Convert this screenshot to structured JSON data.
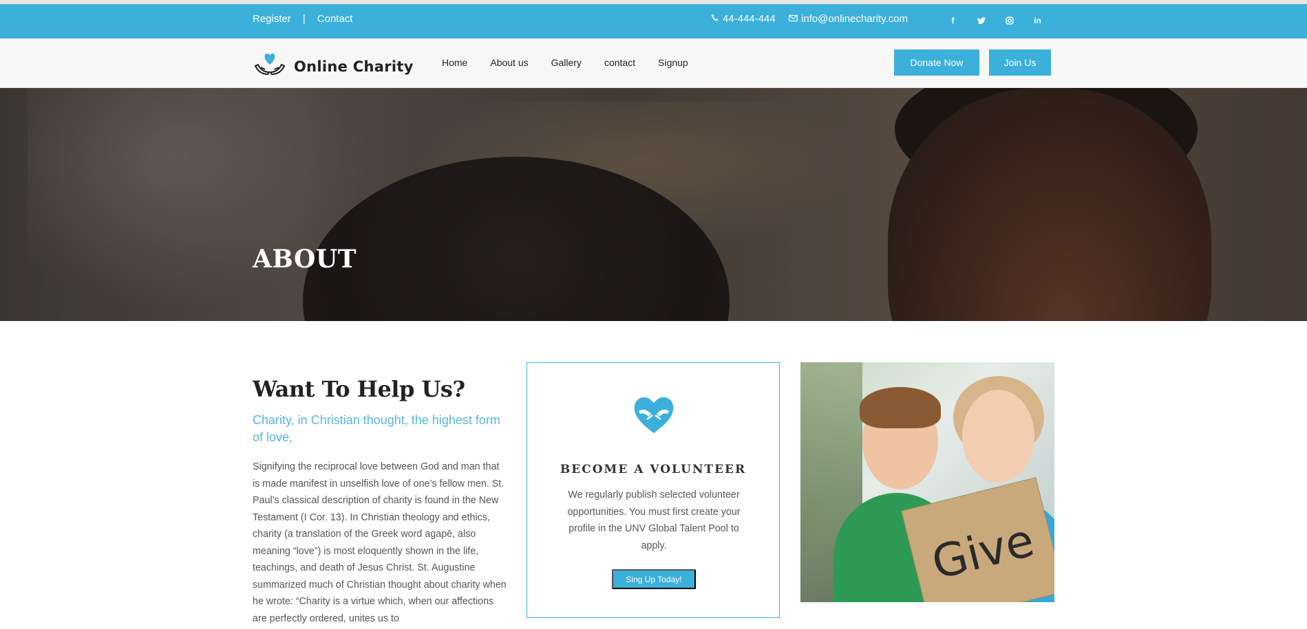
{
  "topbar": {
    "register_label": "Register",
    "separator": "|",
    "contact_label": "Contact",
    "phone": "44-444-444",
    "email": "info@onlinecharity.com",
    "social": [
      {
        "icon": "facebook-icon",
        "glyph": "f"
      },
      {
        "icon": "twitter-icon",
        "glyph": "t"
      },
      {
        "icon": "instagram-icon",
        "glyph": "◎"
      },
      {
        "icon": "linkedin-icon",
        "glyph": "in"
      }
    ],
    "bg_color": "#3bb0db"
  },
  "navbar": {
    "brand": "Online Charity",
    "menu": [
      "Home",
      "About us",
      "Gallery",
      "contact",
      "Signup"
    ],
    "donate_label": "Donate Now",
    "join_label": "Join Us"
  },
  "hero": {
    "title": "ABOUT"
  },
  "intro": {
    "heading": "Want To Help Us?",
    "subheading": "Charity, in Christian thought, the highest form of love,",
    "body": "Signifying the reciprocal love between God and man that is made manifest in unselfish love of one’s fellow men. St. Paul’s classical description of charity is found in the New Testament (I Cor. 13). In Christian theology and ethics, charity (a translation of the Greek word agapē, also meaning “love”) is most eloquently shown in the life, teachings, and death of Jesus Christ. St. Augustine summarized much of Christian thought about charity when he wrote: “Charity is a virtue which, when our affections are perfectly ordered, unites us to"
  },
  "volunteer": {
    "icon": "heart-hands-icon",
    "title": "BECOME A VOLUNTEER",
    "text": "We regularly publish selected volunteer opportunities. You must first create your profile in the UNV Global Talent Pool to apply.",
    "cta_label": "Sing Up Today!"
  },
  "photo": {
    "sign_text": "Give"
  },
  "accent_color": "#3bb0db"
}
